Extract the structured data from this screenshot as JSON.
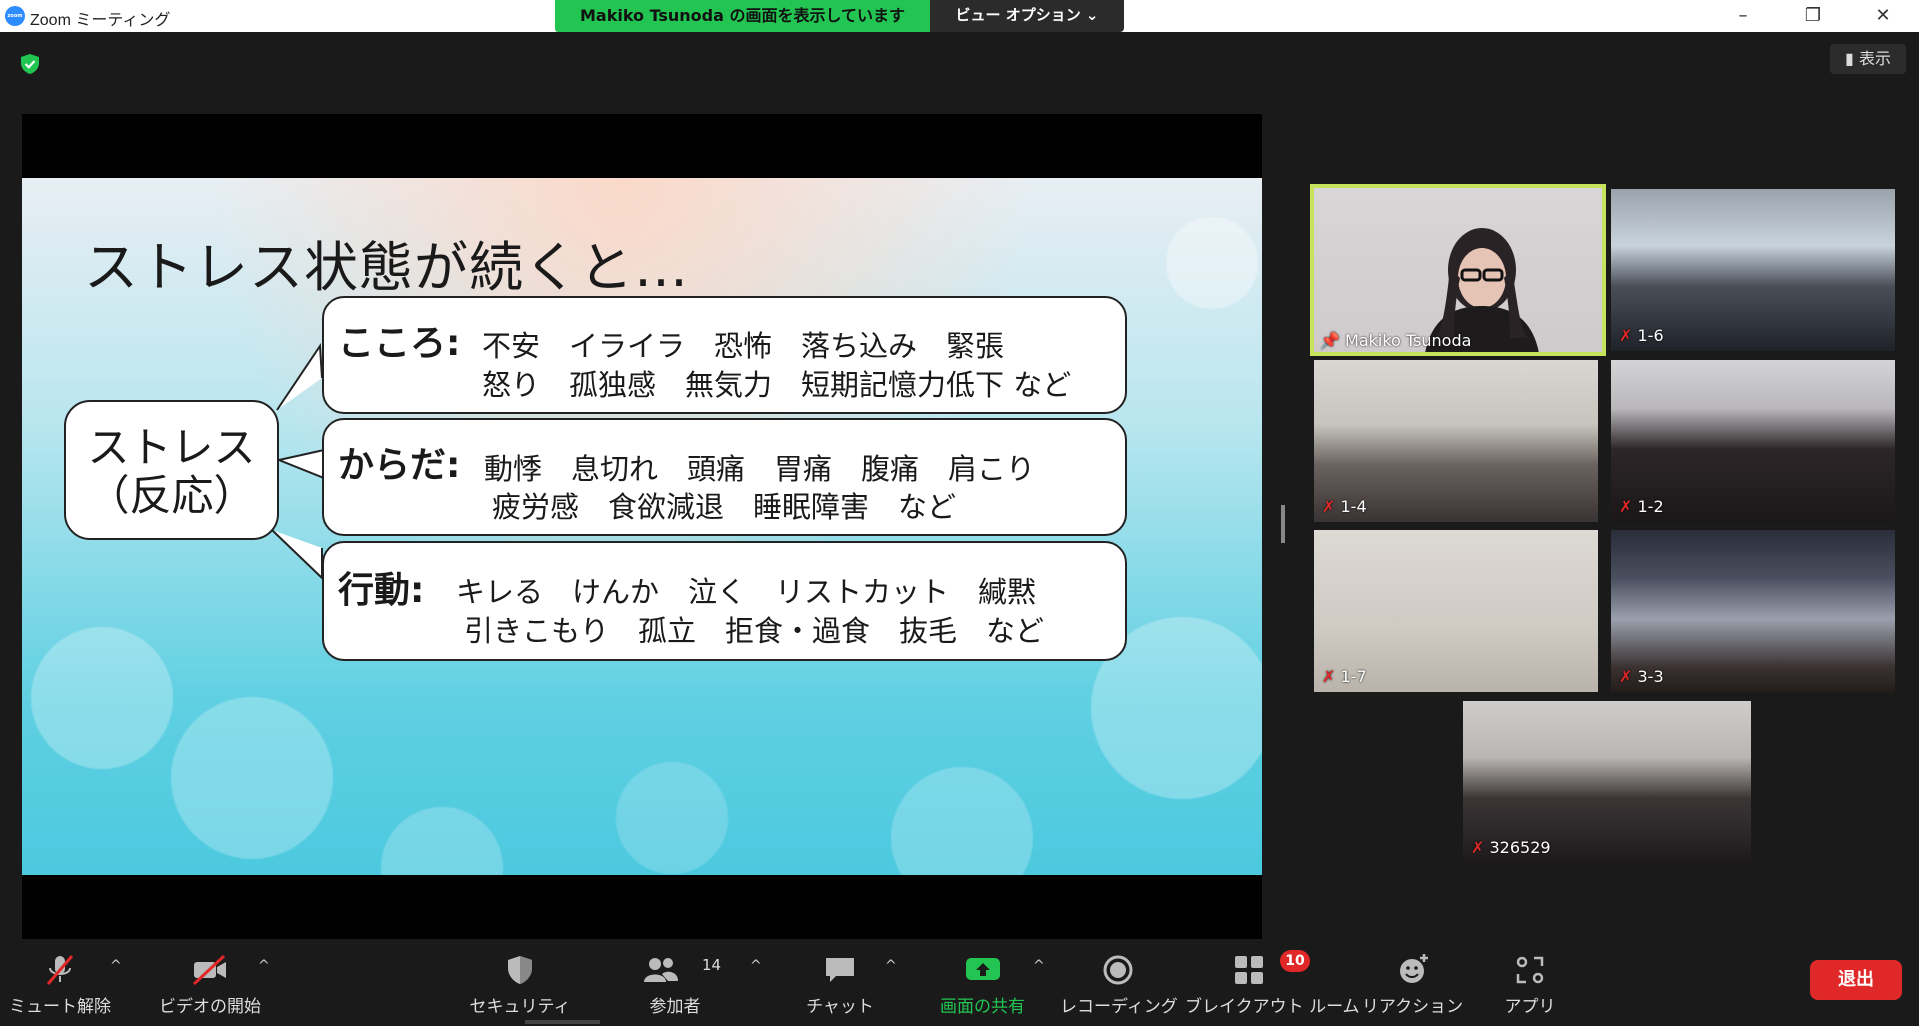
{
  "window": {
    "title": "Zoom ミーティング",
    "logo_text": "zoom",
    "share_banner": "Makiko Tsunoda の画面を表示しています",
    "view_options": "ビュー オプション ⌄",
    "minimize": "–",
    "restore": "❐",
    "close": "✕"
  },
  "top": {
    "view_toggle": "▮ 表示"
  },
  "slide": {
    "title": "ストレス状態が続くと…",
    "center_line1": "ストレス",
    "center_line2": "（反応）",
    "kokoro": {
      "label": "こころ:",
      "line1": "不安　イライラ　恐怖　落ち込み　緊張",
      "line2": "怒り　孤独感　無気力　短期記憶力低下 など"
    },
    "karada": {
      "label": "からだ:",
      "line1": "動悸　息切れ　頭痛　胃痛　腹痛　肩こり",
      "line2": "疲労感　食欲減退　睡眠障害　など"
    },
    "koudou": {
      "label": "行動:",
      "line1": "キレる　けんか　泣く　リストカット　緘黙",
      "line2": "引きこもり　孤立　拒食・過食　抜毛　など"
    }
  },
  "gallery": {
    "tiles": [
      {
        "name": "Makiko Tsunoda",
        "pinned": true
      },
      {
        "name": "1-6"
      },
      {
        "name": "1-4"
      },
      {
        "name": "1-2"
      },
      {
        "name": "1-7"
      },
      {
        "name": "3-3"
      },
      {
        "name": "326529"
      }
    ]
  },
  "toolbar": {
    "unmute": "ミュート解除",
    "start_video": "ビデオの開始",
    "security": "セキュリティ",
    "participants": "参加者",
    "participants_count": "14",
    "chat": "チャット",
    "share_screen": "画面の共有",
    "recording": "レコーディング",
    "breakout": "ブレイクアウト ルーム",
    "breakout_badge": "10",
    "reactions": "リアクション",
    "apps": "アプリ",
    "leave": "退出"
  },
  "colors": {
    "share_green": "#23c552",
    "active_speaker": "#c6e35b",
    "leave_red": "#e02828",
    "muted_red": "#e02828"
  }
}
